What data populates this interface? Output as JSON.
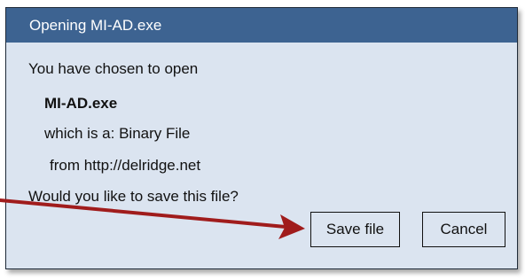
{
  "dialog": {
    "title": "Opening MI-AD.exe",
    "lines": {
      "intro": "You have chosen to open",
      "filename": "MI-AD.exe",
      "type": "which is a: Binary File",
      "source": "from http://delridge.net",
      "question": "Would you like to save this file?"
    },
    "buttons": {
      "save": "Save file",
      "cancel": "Cancel"
    }
  },
  "colors": {
    "titlebar": "#3d6391",
    "dialog_background": "#dbe4f0",
    "arrow": "#a01c1c"
  }
}
